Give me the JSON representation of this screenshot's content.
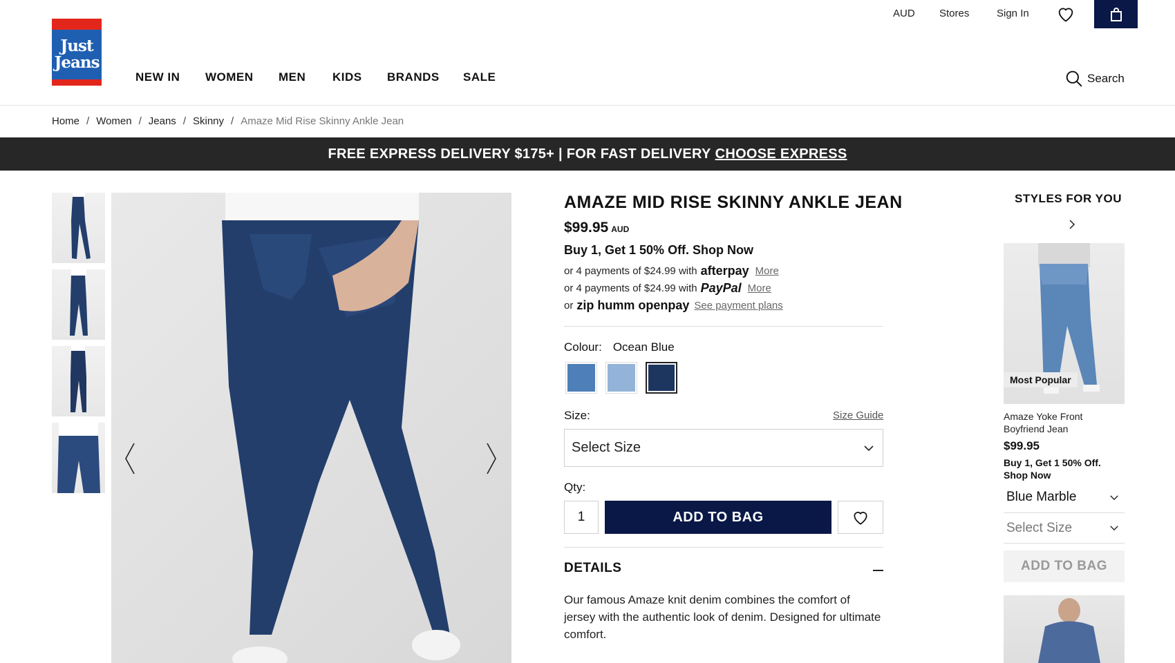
{
  "header": {
    "currency": "AUD",
    "stores": "Stores",
    "sign_in": "Sign In",
    "logo_line1": "Just",
    "logo_line2": "Jeans",
    "nav": [
      "NEW IN",
      "WOMEN",
      "MEN",
      "KIDS",
      "BRANDS",
      "SALE"
    ],
    "search": "Search"
  },
  "breadcrumb": [
    "Home",
    "Women",
    "Jeans",
    "Skinny",
    "Amaze Mid Rise Skinny Ankle Jean"
  ],
  "promo": {
    "text": "FREE EXPRESS DELIVERY $175+ | FOR FAST DELIVERY",
    "link": "CHOOSE EXPRESS"
  },
  "product": {
    "title": "AMAZE MID RISE SKINNY ANKLE JEAN",
    "price": "$99.95",
    "currency": "AUD",
    "offer": "Buy 1, Get 1 50% Off. Shop Now",
    "afterpay": {
      "prefix": "or 4 payments of $24.99 with",
      "brand": "afterpay",
      "more": "More"
    },
    "paypal": {
      "prefix": "or 4 payments of $24.99 with",
      "brand": "PayPal",
      "more": "More"
    },
    "zip": {
      "prefix": "or",
      "brand1": "zip",
      "brand2": "humm",
      "brand3": "openpay",
      "link": "See payment plans"
    },
    "colour_label": "Colour:",
    "colour_value": "Ocean Blue",
    "swatches": [
      "#4f7fb8",
      "#93b4d8",
      "#1d3660"
    ],
    "size_label": "Size:",
    "size_guide": "Size Guide",
    "size_select": "Select Size",
    "qty_label": "Qty:",
    "qty_value": "1",
    "add_to_bag": "ADD TO BAG",
    "details_title": "DETAILS",
    "details_text": "Our famous Amaze knit denim combines the comfort of jersey with the authentic look of denim. Designed for ultimate comfort."
  },
  "styles_for_you": {
    "title": "STYLES FOR YOU",
    "badge": "Most Popular",
    "name": "Amaze Yoke Front Boyfriend Jean",
    "price": "$99.95",
    "offer": "Buy 1, Get 1 50% Off. Shop Now",
    "colour": "Blue Marble",
    "size": "Select Size",
    "add_to_bag": "ADD TO BAG"
  },
  "colors": {
    "navy": "#0a1847",
    "promo_bg": "#272727",
    "logo_red": "#e3261b",
    "logo_blue": "#1f5fb2",
    "denim": "#233e6b"
  }
}
